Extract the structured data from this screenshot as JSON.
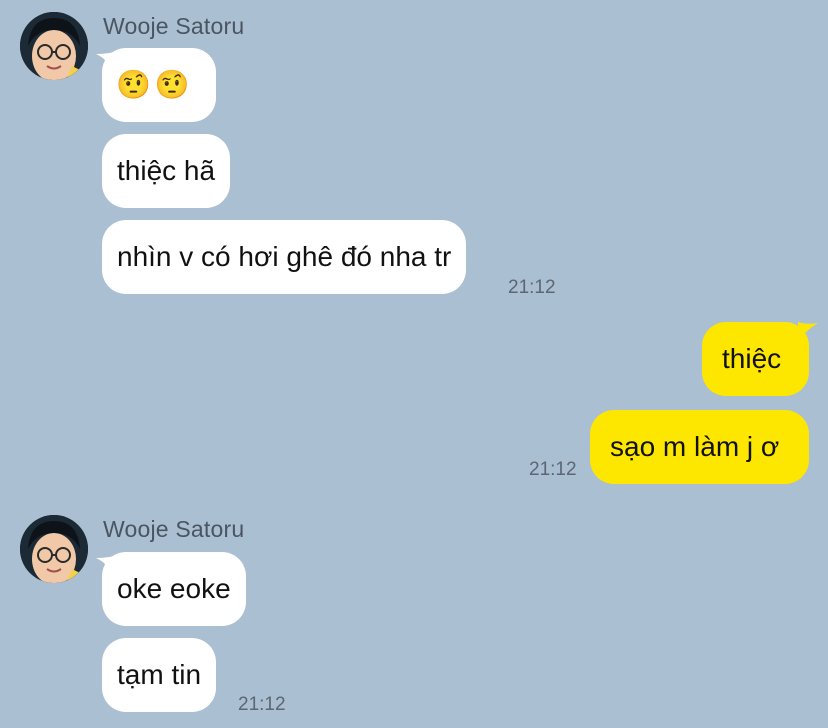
{
  "colors": {
    "background": "#aabfd1",
    "incoming_bubble": "#ffffff",
    "outgoing_bubble": "#fde700"
  },
  "groups": [
    {
      "sender": "Wooje Satoru",
      "avatar_icon": "profile-photo-icon",
      "messages": [
        "🤨🤨",
        "thiệc hã",
        "nhìn v có hơi ghê đó nha tr"
      ],
      "time": "21:12"
    },
    {
      "sender": "me",
      "messages": [
        "thiệc",
        "sạo m làm j ơ"
      ],
      "time": "21:12"
    },
    {
      "sender": "Wooje Satoru",
      "avatar_icon": "profile-photo-icon",
      "messages": [
        "oke eoke",
        "tạm tin"
      ],
      "time": "21:12"
    }
  ]
}
